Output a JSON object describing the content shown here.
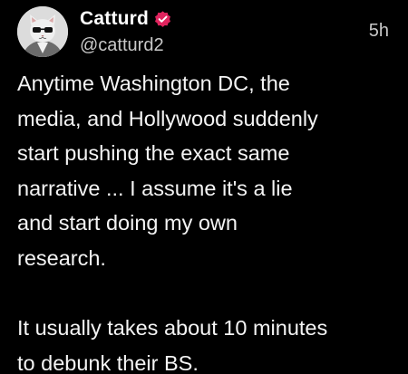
{
  "author": {
    "display_name": "Catturd",
    "handle": "@catturd2",
    "verified": true,
    "avatar": "cat-avatar"
  },
  "timestamp": "5h",
  "body": {
    "paragraph_1": [
      "Anytime Washington DC, the",
      "media, and Hollywood suddenly",
      "start pushing the exact same",
      "narrative ... I assume it's a lie",
      "and start doing my own",
      "research."
    ],
    "paragraph_2": [
      "It usually takes about 10 minutes",
      "to debunk their BS."
    ]
  },
  "colors": {
    "background": "#000000",
    "text": "#ffffff",
    "secondary_text": "#c8c8c8",
    "verified_badge": "#e0245e"
  }
}
